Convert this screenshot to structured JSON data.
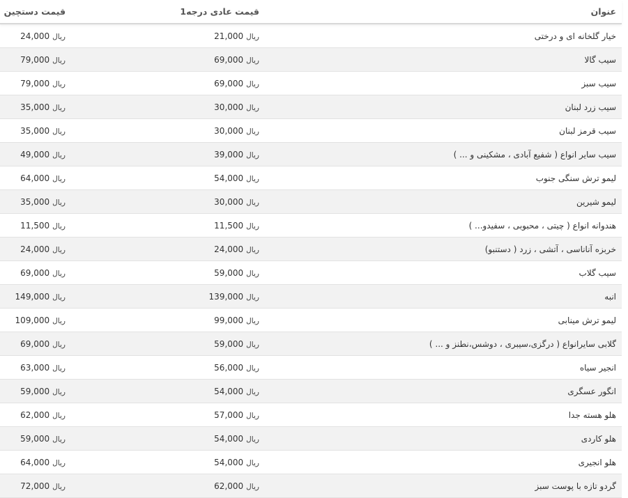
{
  "table": {
    "headers": {
      "title": "عنوان",
      "normal_price": "قیمت عادی درجه1",
      "handpicked_price": "قیمت دستچین"
    },
    "currency": "ریال",
    "rows": [
      {
        "title": "خیار گلخانه ای و درختی",
        "normal": "21,000",
        "handpicked": "24,000"
      },
      {
        "title": "سیب گالا",
        "normal": "69,000",
        "handpicked": "79,000"
      },
      {
        "title": "سیب سبز",
        "normal": "69,000",
        "handpicked": "79,000"
      },
      {
        "title": "سیب زرد لبنان",
        "normal": "30,000",
        "handpicked": "35,000"
      },
      {
        "title": "سیب قرمز لبنان",
        "normal": "30,000",
        "handpicked": "35,000"
      },
      {
        "title": "سیب سایر انواع ( شفیع آبادی ، مشکینی و ... )",
        "normal": "39,000",
        "handpicked": "49,000"
      },
      {
        "title": "لیمو ترش سنگی جنوب",
        "normal": "54,000",
        "handpicked": "64,000"
      },
      {
        "title": "لیمو شیرین",
        "normal": "30,000",
        "handpicked": "35,000"
      },
      {
        "title": "هندوانه انواع ( چیتی ، محبوبی ، سفیدو... )",
        "normal": "11,500",
        "handpicked": "11,500"
      },
      {
        "title": "خربزه آناناسی ، آتشی ، زرد ( دستنبو)",
        "normal": "24,000",
        "handpicked": "24,000"
      },
      {
        "title": "سیب گلاب",
        "normal": "59,000",
        "handpicked": "69,000"
      },
      {
        "title": "انبه",
        "normal": "139,000",
        "handpicked": "149,000"
      },
      {
        "title": "لیمو ترش مینابی",
        "normal": "99,000",
        "handpicked": "109,000"
      },
      {
        "title": "گلابی سایرانواع ( درگزی،سیبری ، دوشس،نطنز و ... )",
        "normal": "59,000",
        "handpicked": "69,000"
      },
      {
        "title": "انجیر سیاه",
        "normal": "56,000",
        "handpicked": "63,000"
      },
      {
        "title": "انگور عسگری",
        "normal": "54,000",
        "handpicked": "59,000"
      },
      {
        "title": "هلو هسته جدا",
        "normal": "57,000",
        "handpicked": "62,000"
      },
      {
        "title": "هلو کاردی",
        "normal": "54,000",
        "handpicked": "59,000"
      },
      {
        "title": "هلو انجیری",
        "normal": "54,000",
        "handpicked": "64,000"
      },
      {
        "title": "گردو تازه با پوست سبز",
        "normal": "62,000",
        "handpicked": "72,000"
      }
    ]
  }
}
